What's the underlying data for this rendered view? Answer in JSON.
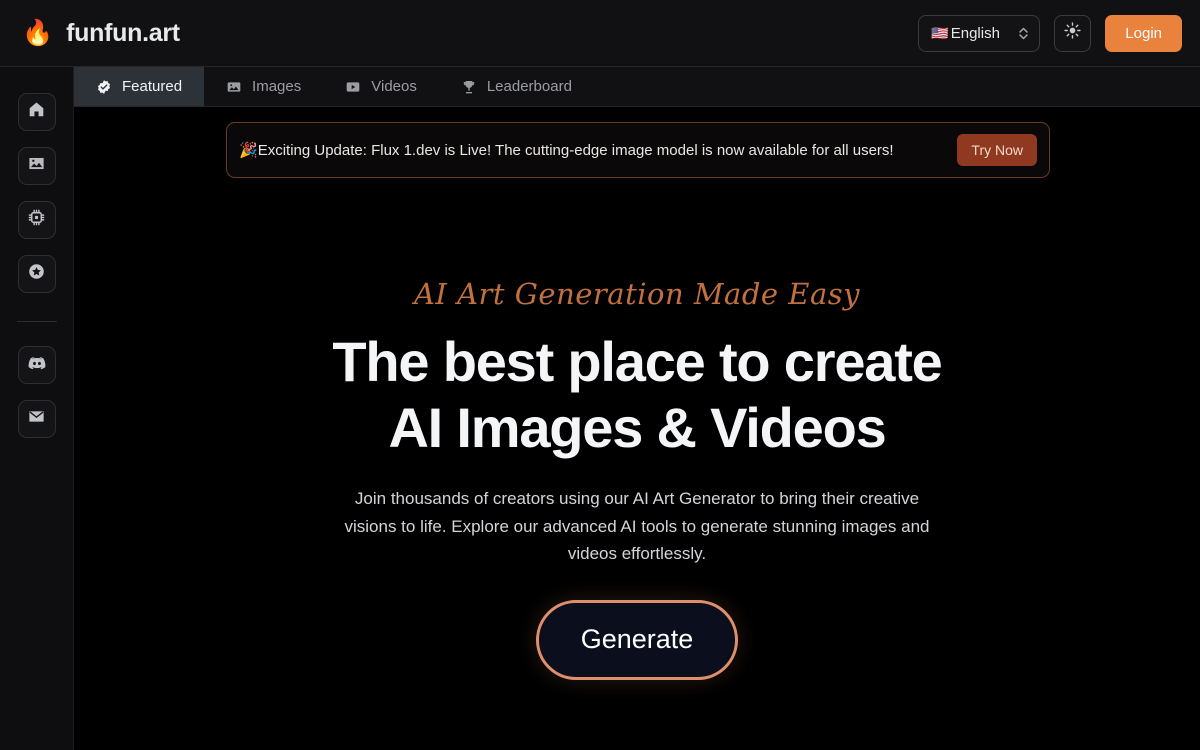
{
  "header": {
    "flame_icon": "🔥",
    "brand_name": "funfun.art",
    "language": {
      "flag": "🇺🇸",
      "label": "English",
      "icon": "chevron-updown-icon"
    },
    "theme_toggle_icon": "sun-icon",
    "login_label": "Login"
  },
  "sidebar": {
    "items": [
      {
        "name": "home",
        "icon": "home-icon"
      },
      {
        "name": "gallery",
        "icon": "image-icon"
      },
      {
        "name": "models",
        "icon": "cpu-chip-icon"
      },
      {
        "name": "favorites",
        "icon": "star-circle-icon"
      },
      {
        "name": "discord",
        "icon": "discord-icon"
      },
      {
        "name": "mail",
        "icon": "mail-icon"
      }
    ]
  },
  "tabs": [
    {
      "label": "Featured",
      "icon": "verified-badge-icon",
      "active": true
    },
    {
      "label": "Images",
      "icon": "image-icon",
      "active": false
    },
    {
      "label": "Videos",
      "icon": "video-play-icon",
      "active": false
    },
    {
      "label": "Leaderboard",
      "icon": "trophy-icon",
      "active": false
    }
  ],
  "banner": {
    "emoji": "🎉",
    "text": "Exciting Update: Flux 1.dev is Live! The cutting-edge image model is now available for all users!",
    "cta_label": "Try Now"
  },
  "hero": {
    "eyebrow": "AI Art Generation Made Easy",
    "headline_line1": "The best place to create",
    "headline_line2": "AI Images & Videos",
    "subtitle": "Join thousands of creators using our AI Art Generator to bring their creative visions to life. Explore our advanced AI tools to generate stunning images and videos effortlessly.",
    "cta_label": "Generate"
  },
  "colors": {
    "page_background": "#000000",
    "header_background": "#111113",
    "sidebar_background": "#0e0e10",
    "accent_orange": "#e8823c",
    "banner_border": "#6b3a22",
    "banner_cta": "#8f3a20",
    "eyebrow_text": "#c2703f",
    "generate_border": "#e08f6c",
    "generate_fill": "#0b0e1c",
    "active_tab_background": "#2d3138"
  }
}
